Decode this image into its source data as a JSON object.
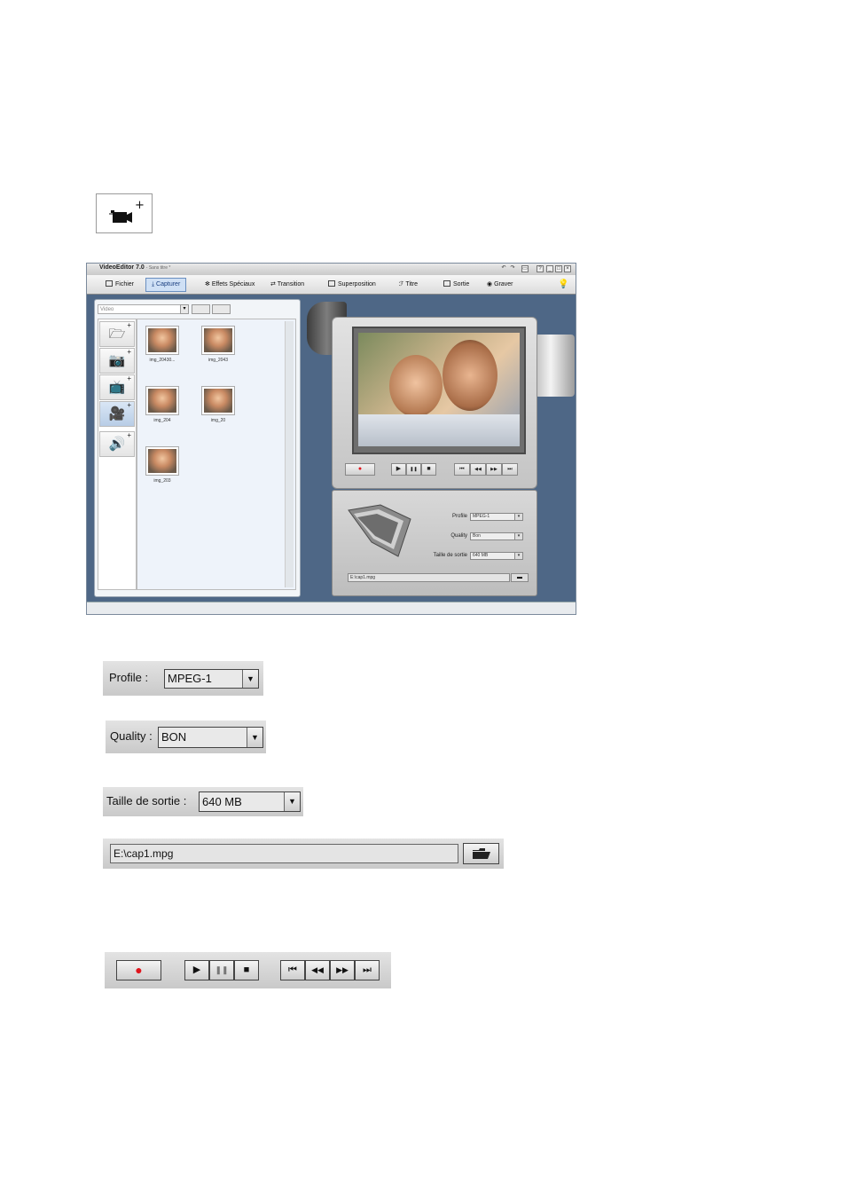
{
  "top_icon": {
    "name": "add-video-capture-icon"
  },
  "app": {
    "title": "VideoEditor 7.0",
    "subtitle": "- Sans titre *",
    "menu": [
      {
        "label": "Fichier",
        "icon": "file-icon"
      },
      {
        "label": "Capturer",
        "icon": "capture-icon"
      },
      {
        "label": "Effets Spéciaux",
        "icon": "effects-icon"
      },
      {
        "label": "Transition",
        "icon": "transition-icon"
      },
      {
        "label": "Superposition",
        "icon": "overlay-icon"
      },
      {
        "label": "Titre",
        "icon": "title-icon"
      },
      {
        "label": "Sortie",
        "icon": "output-icon"
      },
      {
        "label": "Graver",
        "icon": "burn-icon"
      }
    ],
    "media_type": "Video",
    "thumbnails": [
      {
        "label": "img_20430..."
      },
      {
        "label": "img_2043"
      },
      {
        "label": "img_204"
      },
      {
        "label": "img_20"
      },
      {
        "label": "img_203"
      }
    ],
    "settings": {
      "profile_label": "Profile",
      "profile_value": "MPEG-1",
      "quality_label": "Quality",
      "quality_value": "Bon",
      "size_label": "Taille de sortie",
      "size_value": "640 MB",
      "path": "E:\\cap1.mpg"
    }
  },
  "zoomed": {
    "profile_label": "Profile :",
    "profile_value": "MPEG-1",
    "quality_label": "Quality :",
    "quality_value": "BON",
    "size_label": "Taille de sortie  :",
    "size_value": "640 MB",
    "path": "E:\\cap1.mpg"
  },
  "controls": {
    "record": "●",
    "play": "▶",
    "pause": "❚❚",
    "stop": "■",
    "prev": "⏮",
    "rewind": "◀◀",
    "forward": "▶▶",
    "next": "⏭"
  },
  "colors": {
    "accent": "#1b3f80",
    "record": "#e0141c",
    "panel_bg": "#4e6786"
  }
}
